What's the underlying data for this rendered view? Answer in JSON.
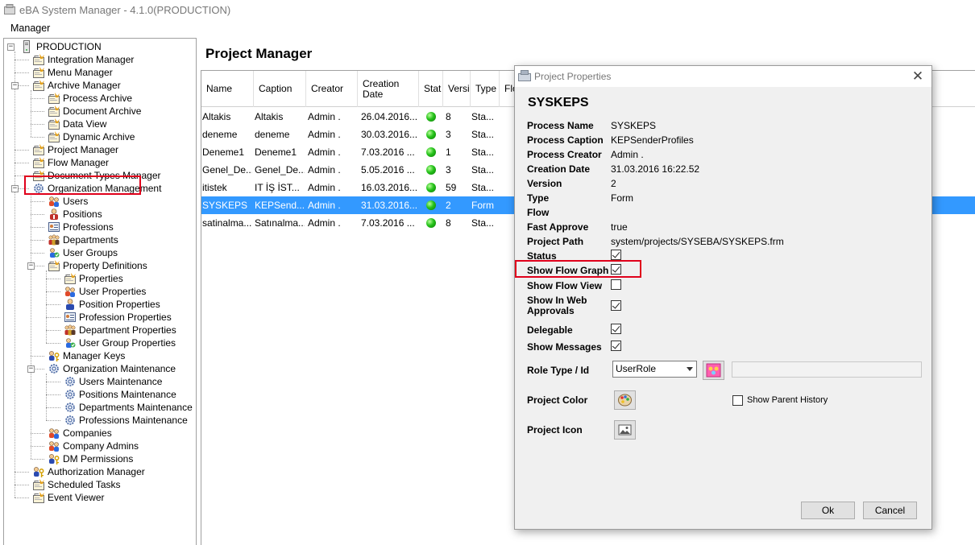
{
  "window": {
    "title": "eBA System Manager - 4.1.0(PRODUCTION)"
  },
  "menu": {
    "items": [
      "Manager"
    ]
  },
  "tree": {
    "root": "PRODUCTION",
    "items": [
      {
        "label": "Integration Manager",
        "icon": "folder-icon"
      },
      {
        "label": "Menu Manager",
        "icon": "folder-icon"
      },
      {
        "label": "Archive Manager",
        "icon": "folder-icon"
      },
      {
        "label": "Process Archive",
        "icon": "folder-icon"
      },
      {
        "label": "Document Archive",
        "icon": "folder-icon"
      },
      {
        "label": "Data View",
        "icon": "folder-icon"
      },
      {
        "label": "Dynamic Archive",
        "icon": "folder-icon"
      },
      {
        "label": "Project Manager",
        "icon": "folder-icon"
      },
      {
        "label": "Flow Manager",
        "icon": "folder-icon"
      },
      {
        "label": "Document Types Manager",
        "icon": "folder-icon"
      },
      {
        "label": "Organization Management",
        "icon": "gear-icon"
      },
      {
        "label": "Users",
        "icon": "users-icon"
      },
      {
        "label": "Positions",
        "icon": "positions-icon"
      },
      {
        "label": "Professions",
        "icon": "professions-icon"
      },
      {
        "label": "Departments",
        "icon": "departments-icon"
      },
      {
        "label": "User Groups",
        "icon": "user-groups-icon"
      },
      {
        "label": "Property Definitions",
        "icon": "folder-icon"
      },
      {
        "label": "Properties",
        "icon": "folder-icon"
      },
      {
        "label": "User Properties",
        "icon": "users-icon"
      },
      {
        "label": "Position Properties",
        "icon": "person-icon"
      },
      {
        "label": "Profession Properties",
        "icon": "professions-icon"
      },
      {
        "label": "Department Properties",
        "icon": "departments-icon"
      },
      {
        "label": "User Group Properties",
        "icon": "user-groups-icon"
      },
      {
        "label": "Manager Keys",
        "icon": "key-icon"
      },
      {
        "label": "Organization Maintenance",
        "icon": "gear-icon"
      },
      {
        "label": "Users Maintenance",
        "icon": "gear-icon"
      },
      {
        "label": "Positions Maintenance",
        "icon": "gear-icon"
      },
      {
        "label": "Departments Maintenance",
        "icon": "gear-icon"
      },
      {
        "label": "Professions Maintenance",
        "icon": "gear-icon"
      },
      {
        "label": "Companies",
        "icon": "users-icon"
      },
      {
        "label": "Company Admins",
        "icon": "users-icon"
      },
      {
        "label": "DM Permissions",
        "icon": "key-icon"
      },
      {
        "label": "Authorization Manager",
        "icon": "key-icon"
      },
      {
        "label": "Scheduled Tasks",
        "icon": "folder-icon"
      },
      {
        "label": "Event Viewer",
        "icon": "folder-icon"
      }
    ]
  },
  "project_manager": {
    "title": "Project Manager",
    "columns": [
      "Name",
      "Caption",
      "Creator",
      "Creation Date",
      "Stat",
      "Versi",
      "Type",
      "Flo"
    ],
    "rows": [
      {
        "name": "Altakis",
        "caption": "Altakis",
        "creator": "Admin .",
        "date": "26.04.2016...",
        "version": "8",
        "type": "Sta..."
      },
      {
        "name": "deneme",
        "caption": "deneme",
        "creator": "Admin .",
        "date": "30.03.2016...",
        "version": "3",
        "type": "Sta..."
      },
      {
        "name": "Deneme1",
        "caption": "Deneme1",
        "creator": "Admin .",
        "date": "7.03.2016 ...",
        "version": "1",
        "type": "Sta..."
      },
      {
        "name": "Genel_De...",
        "caption": "Genel_De...",
        "creator": "Admin .",
        "date": "5.05.2016 ...",
        "version": "3",
        "type": "Sta..."
      },
      {
        "name": "itistek",
        "caption": "IT İŞ İST...",
        "creator": "Admin .",
        "date": "16.03.2016...",
        "version": "59",
        "type": "Sta..."
      },
      {
        "name": "SYSKEPS",
        "caption": "KEPSend...",
        "creator": "Admin .",
        "date": "31.03.2016...",
        "version": "2",
        "type": "Form"
      },
      {
        "name": "satinalma...",
        "caption": "Satınalma...",
        "creator": "Admin .",
        "date": "7.03.2016 ...",
        "version": "8",
        "type": "Sta..."
      }
    ]
  },
  "dialog": {
    "title": "Project Properties",
    "project_name": "SYSKEPS",
    "fields": [
      {
        "label": "Process Name",
        "value": "SYSKEPS"
      },
      {
        "label": "Process Caption",
        "value": "KEPSenderProfiles"
      },
      {
        "label": "Process Creator",
        "value": "Admin ."
      },
      {
        "label": "Creation Date",
        "value": "31.03.2016 16:22.52"
      },
      {
        "label": "Version",
        "value": "2"
      },
      {
        "label": "Type",
        "value": "Form"
      },
      {
        "label": "Flow",
        "value": ""
      },
      {
        "label": "Fast Approve",
        "value": "true"
      },
      {
        "label": "Project Path",
        "value": "system/projects/SYSEBA/SYSKEPS.frm"
      }
    ],
    "checks": [
      {
        "label": "Status",
        "checked": true
      },
      {
        "label": "Show Flow Graph",
        "checked": true
      },
      {
        "label": "Show Flow View",
        "checked": false
      },
      {
        "label": "Show In Web Approvals",
        "checked": true
      },
      {
        "label": "Delegable",
        "checked": true
      },
      {
        "label": "Show Messages",
        "checked": true
      }
    ],
    "role_type_label": "Role Type / Id",
    "role_type_value": "UserRole",
    "project_color_label": "Project Color",
    "project_icon_label": "Project Icon",
    "show_parent_history_label": "Show Parent History",
    "ok_label": "Ok",
    "cancel_label": "Cancel"
  }
}
